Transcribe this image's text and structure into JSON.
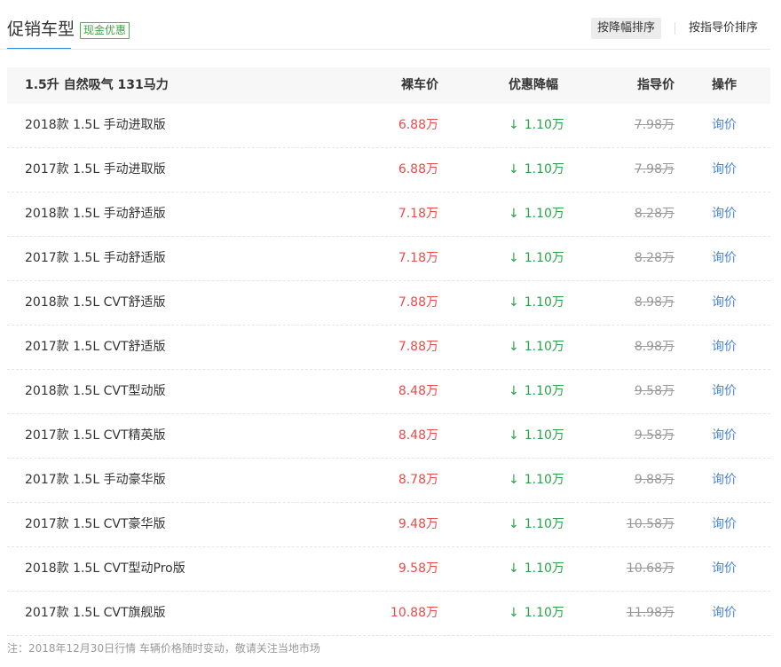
{
  "header": {
    "title": "促销车型",
    "badge": "现金优惠",
    "sort_by_discount": "按降幅排序",
    "sort_by_guide": "按指导价排序"
  },
  "table": {
    "group_title": "1.5升 自然吸气 131马力",
    "col_price": "裸车价",
    "col_discount": "优惠降幅",
    "col_guide": "指导价",
    "col_action": "操作",
    "rows": [
      {
        "name": "2018款 1.5L 手动进取版",
        "price": "6.88万",
        "discount": "1.10万",
        "guide": "7.98万",
        "action": "询价"
      },
      {
        "name": "2017款 1.5L 手动进取版",
        "price": "6.88万",
        "discount": "1.10万",
        "guide": "7.98万",
        "action": "询价"
      },
      {
        "name": "2018款 1.5L 手动舒适版",
        "price": "7.18万",
        "discount": "1.10万",
        "guide": "8.28万",
        "action": "询价"
      },
      {
        "name": "2017款 1.5L 手动舒适版",
        "price": "7.18万",
        "discount": "1.10万",
        "guide": "8.28万",
        "action": "询价"
      },
      {
        "name": "2018款 1.5L CVT舒适版",
        "price": "7.88万",
        "discount": "1.10万",
        "guide": "8.98万",
        "action": "询价"
      },
      {
        "name": "2017款 1.5L CVT舒适版",
        "price": "7.88万",
        "discount": "1.10万",
        "guide": "8.98万",
        "action": "询价"
      },
      {
        "name": "2018款 1.5L CVT型动版",
        "price": "8.48万",
        "discount": "1.10万",
        "guide": "9.58万",
        "action": "询价"
      },
      {
        "name": "2017款 1.5L CVT精英版",
        "price": "8.48万",
        "discount": "1.10万",
        "guide": "9.58万",
        "action": "询价"
      },
      {
        "name": "2017款 1.5L 手动豪华版",
        "price": "8.78万",
        "discount": "1.10万",
        "guide": "9.88万",
        "action": "询价"
      },
      {
        "name": "2017款 1.5L CVT豪华版",
        "price": "9.48万",
        "discount": "1.10万",
        "guide": "10.58万",
        "action": "询价"
      },
      {
        "name": "2018款 1.5L CVT型动Pro版",
        "price": "9.58万",
        "discount": "1.10万",
        "guide": "10.68万",
        "action": "询价"
      },
      {
        "name": "2017款 1.5L CVT旗舰版",
        "price": "10.88万",
        "discount": "1.10万",
        "guide": "11.98万",
        "action": "询价"
      }
    ]
  },
  "note": "注：2018年12月30日行情 车辆价格随时变动，敬请关注当地市场",
  "icons": {
    "discount_arrow": "↓"
  },
  "colors": {
    "price": "#e94b4b",
    "discount": "#2aa34a",
    "link": "#4a86d0",
    "accent": "#3a86d6"
  }
}
